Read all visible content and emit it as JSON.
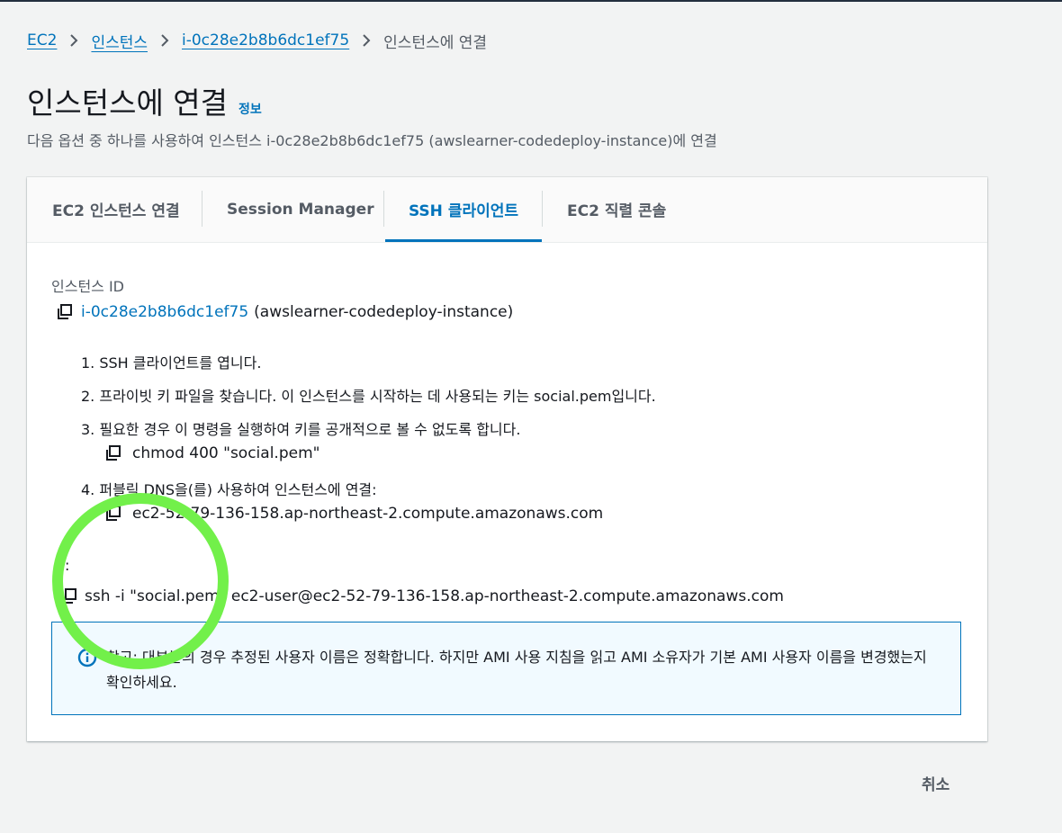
{
  "breadcrumb": {
    "items": [
      "EC2",
      "인스턴스",
      "i-0c28e2b8b6dc1ef75"
    ],
    "current": "인스턴스에 연결"
  },
  "header": {
    "title": "인스턴스에 연결",
    "info_link": "정보",
    "description": "다음 옵션 중 하나를 사용하여 인스턴스 i-0c28e2b8b6dc1ef75 (awslearner-codedeploy-instance)에 연결"
  },
  "tabs": [
    {
      "label": "EC2 인스턴스 연결",
      "active": false
    },
    {
      "label": "Session Manager",
      "active": false
    },
    {
      "label": "SSH 클라이언트",
      "active": true
    },
    {
      "label": "EC2 직렬 콘솔",
      "active": false
    }
  ],
  "instance": {
    "label": "인스턴스 ID",
    "id": "i-0c28e2b8b6dc1ef75",
    "name": "(awslearner-codedeploy-instance)"
  },
  "steps": [
    "1. SSH 클라이언트를 엽니다.",
    "2. 프라이빗 키 파일을 찾습니다. 이 인스턴스를 시작하는 데 사용되는 키는 social.pem입니다.",
    "3. 필요한 경우 이 명령을 실행하여 키를 공개적으로 볼 수 없도록 합니다.",
    "4. 퍼블릭 DNS을(를) 사용하여 인스턴스에 연결:"
  ],
  "commands": {
    "chmod": "chmod 400 \"social.pem\"",
    "dns": "ec2-52-79-136-158.ap-northeast-2.compute.amazonaws.com"
  },
  "example": {
    "label": ":",
    "command": "ssh -i \"social.pem\" ec2-user@ec2-52-79-136-158.ap-northeast-2.compute.amazonaws.com"
  },
  "alert": {
    "text": "참고: 대부분의 경우 추정된 사용자 이름은 정확합니다. 하지만 AMI 사용 지침을 읽고 AMI 소유자가 기본 AMI 사용자 이름을 변경했는지 확인하세요."
  },
  "footer": {
    "cancel_label": "취소"
  },
  "colors": {
    "link": "#0073bb",
    "annotation_ring": "#72f04a",
    "alert_bg": "#f1faff"
  }
}
